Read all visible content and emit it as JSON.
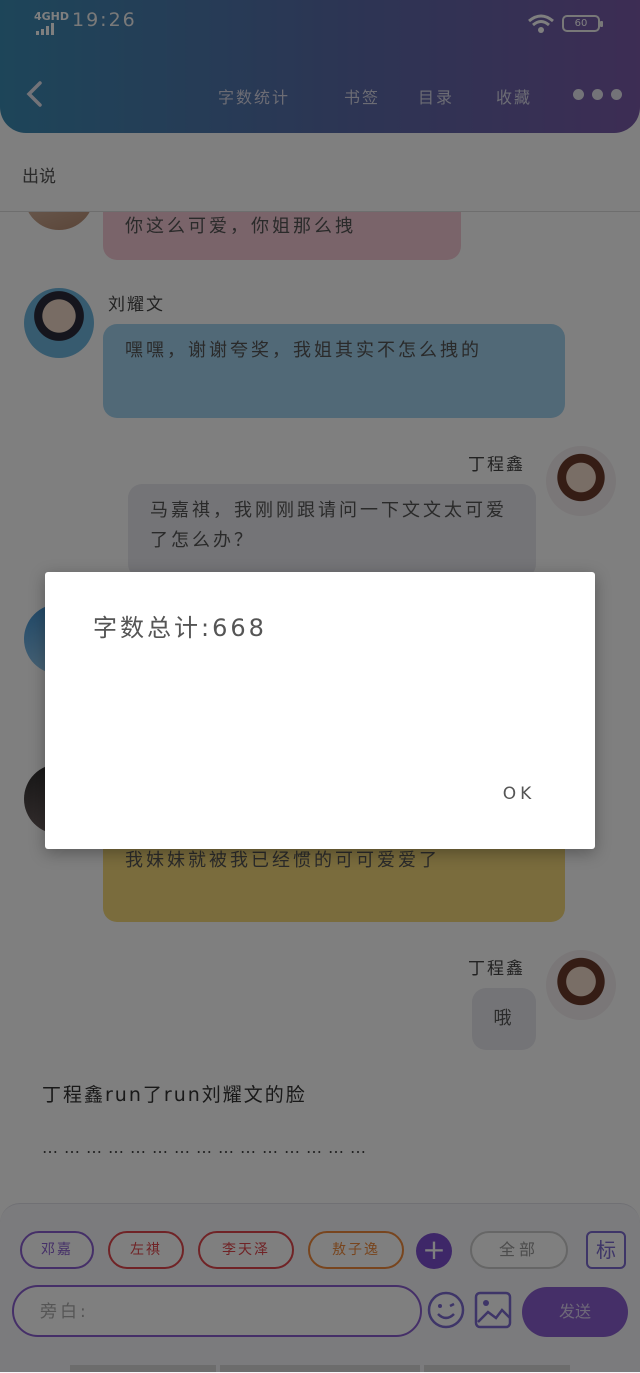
{
  "status_bar": {
    "network": "4GHD",
    "time": "19:26",
    "battery": "60"
  },
  "header": {
    "nav_items": [
      "字数统计",
      "书签",
      "目录",
      "收藏"
    ]
  },
  "subheader": {
    "title": "出说"
  },
  "messages": [
    {
      "side": "left",
      "sender": "",
      "text": "你这么可爱，你姐那么拽",
      "color": "#f5c9d4"
    },
    {
      "side": "left",
      "sender": "刘耀文",
      "text": "嘿嘿，谢谢夸奖，我姐其实不怎么拽的",
      "color": "#a3d2ef"
    },
    {
      "side": "right",
      "sender": "丁程鑫",
      "text": "马嘉祺，我刚刚跟请问一下文文太可爱了怎么办？",
      "color": "#e9e9ee"
    },
    {
      "side": "left",
      "sender": "",
      "text": "我妹妹就被我已经惯的可可爱爱了",
      "color": "#f5d97a"
    },
    {
      "side": "right",
      "sender": "丁程鑫",
      "text": "哦",
      "color": "#e9e9ee"
    }
  ],
  "narration": "丁程鑫run了run刘耀文的脸",
  "ellipsis": "………………………………………",
  "bottom_bar": {
    "tags": [
      {
        "label": "邓嘉",
        "color": "#8a5fd0"
      },
      {
        "label": "左祺",
        "color": "#e0474c"
      },
      {
        "label": "李天泽",
        "color": "#e0474c"
      },
      {
        "label": "敖子逸",
        "color": "#f08a3c"
      }
    ],
    "add_label": "+",
    "all_label": "全部",
    "mark_label": "标",
    "input_placeholder": "旁白:",
    "send_label": "发送"
  },
  "dialog": {
    "message": "字数总计:668",
    "ok_label": "OK"
  }
}
